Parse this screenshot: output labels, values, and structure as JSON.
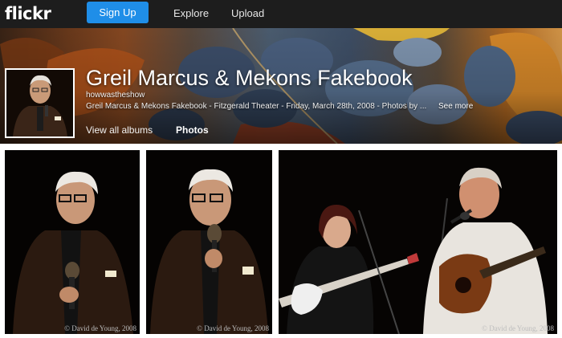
{
  "nav": {
    "logo": "flickr",
    "signup_label": "Sign Up",
    "explore_label": "Explore",
    "upload_label": "Upload"
  },
  "album": {
    "title": "Greil Marcus & Mekons Fakebook",
    "username": "howwastheshow",
    "description": "Greil Marcus & Mekons Fakebook - Fitzgerald Theater - Friday, March 28th, 2008 - Photos by ...",
    "see_more": "See more"
  },
  "subnav": {
    "albums_label": "View all albums",
    "photos_label": "Photos"
  },
  "photos": [
    {
      "copyright": "© David de Young, 2008"
    },
    {
      "copyright": "© David de Young, 2008"
    },
    {
      "copyright": "© David de Young, 2008"
    }
  ],
  "colors": {
    "nav_background": "#1d1d1d",
    "signup_button": "#1f8ee8"
  }
}
